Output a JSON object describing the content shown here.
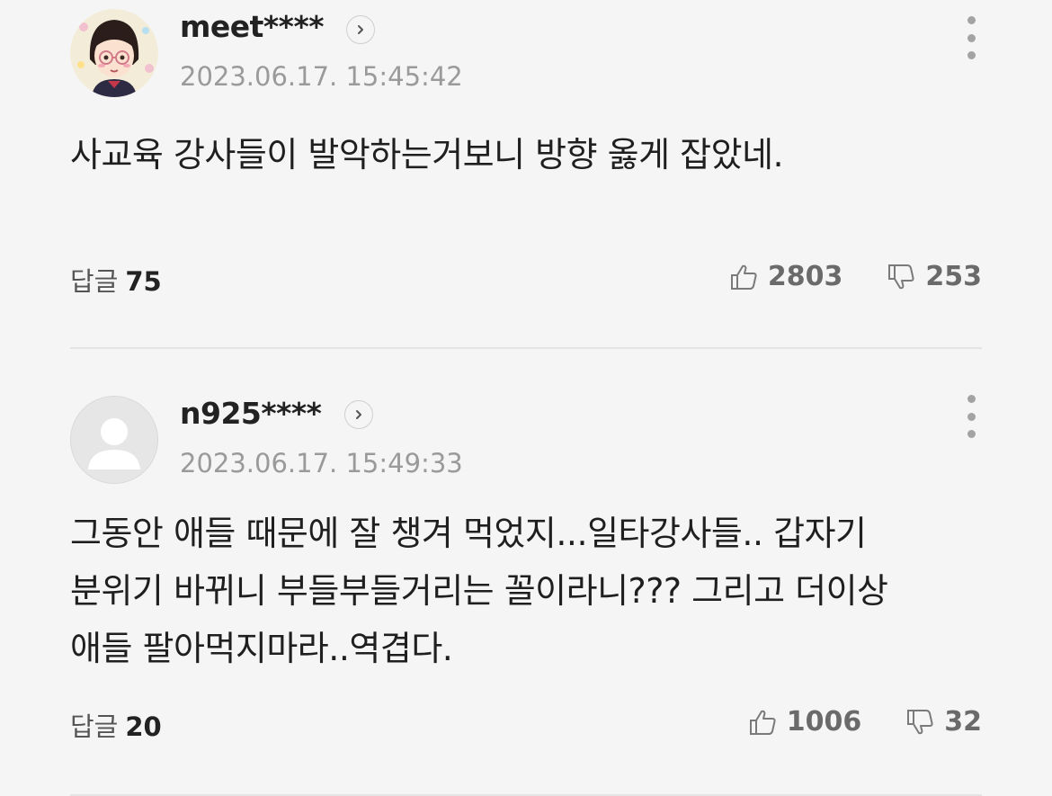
{
  "comments": [
    {
      "username": "meet****",
      "timestamp": "2023.06.17. 15:45:42",
      "content": "사교육 강사들이 발악하는거보니 방향 옳게 잡았네.",
      "reply_label": "답글",
      "reply_count": "75",
      "likes": "2803",
      "dislikes": "253",
      "avatar": "cartoon-girl-avatar"
    },
    {
      "username": "n925****",
      "timestamp": "2023.06.17. 15:49:33",
      "content": "그동안 애들 때문에 잘 챙겨 먹었지...일타강사들.. 갑자기 분위기 바뀌니 부들부들거리는 꼴이라니??? 그리고 더이상 애들 팔아먹지마라..역겹다.",
      "reply_label": "답글",
      "reply_count": "20",
      "likes": "1006",
      "dislikes": "32",
      "avatar": "default-user-avatar"
    }
  ],
  "icons": {
    "profile_arrow": "chevron-right-icon",
    "more": "more-vertical-icon",
    "like": "thumbs-up-icon",
    "dislike": "thumbs-down-icon"
  },
  "colors": {
    "background": "#f5f5f5",
    "text": "#1f1f1f",
    "muted": "#9a9a9a"
  }
}
